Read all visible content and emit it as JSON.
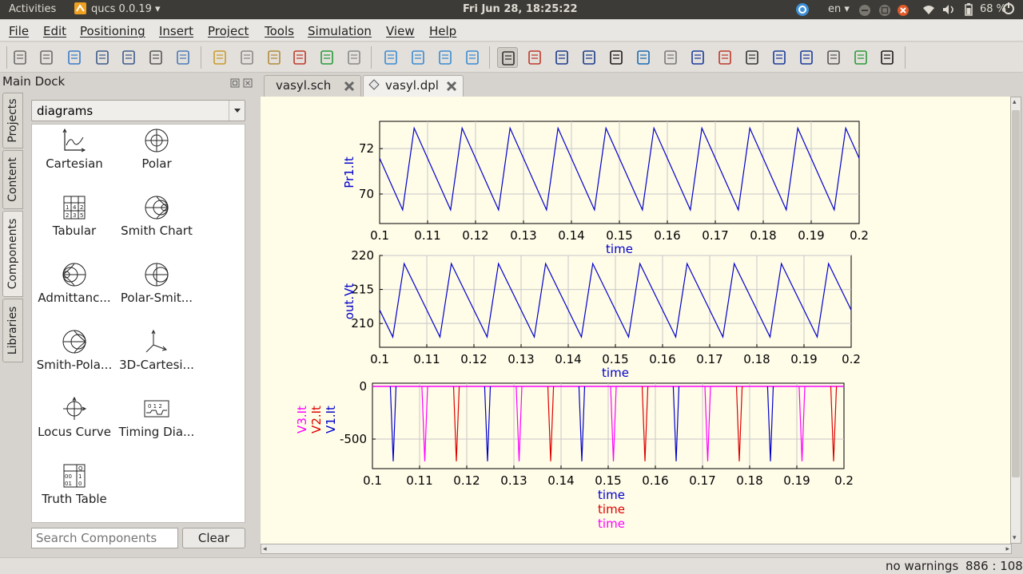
{
  "system_bar": {
    "activities": "Activities",
    "app_name": "qucs 0.0.19",
    "datetime": "Fri Jun 28, 18:25:22",
    "language": "en",
    "battery": "68 %"
  },
  "menu": [
    "File",
    "Edit",
    "Positioning",
    "Insert",
    "Project",
    "Tools",
    "Simulation",
    "View",
    "Help"
  ],
  "toolbar_icons": [
    "new-file-icon",
    "new-text-icon",
    "open-folder-icon",
    "save-icon",
    "save-all-icon",
    "close-icon",
    "print-icon",
    "cut-icon",
    "copy-icon",
    "paste-icon",
    "delete-icon",
    "undo-icon",
    "redo-icon",
    "zoom-fit-icon",
    "zoom-selection-icon",
    "zoom-in-icon",
    "zoom-out-icon",
    "select-arrow-icon",
    "edit-component-icon",
    "mirror-x-icon",
    "mirror-y-icon",
    "rotate-icon",
    "enter-subcircuit-icon",
    "exit-subcircuit-icon",
    "wire-icon",
    "wire-label-icon",
    "equation-icon",
    "ground-icon",
    "port-icon",
    "simulate-icon",
    "data-display-icon",
    "marker-icon"
  ],
  "dock": {
    "title": "Main Dock",
    "vertical_tabs": [
      "Projects",
      "Content",
      "Components",
      "Libraries"
    ],
    "category": "diagrams",
    "components": [
      {
        "label": "Cartesian",
        "icon": "cartesian-diagram-icon"
      },
      {
        "label": "Polar",
        "icon": "polar-diagram-icon"
      },
      {
        "label": "Tabular",
        "icon": "tabular-diagram-icon"
      },
      {
        "label": "Smith Chart",
        "icon": "smith-chart-icon"
      },
      {
        "label": "Admittanc...",
        "icon": "admittance-smith-icon"
      },
      {
        "label": "Polar-Smit...",
        "icon": "polar-smith-icon"
      },
      {
        "label": "Smith-Pola...",
        "icon": "smith-polar-icon"
      },
      {
        "label": "3D-Cartesi...",
        "icon": "3d-cartesian-icon"
      },
      {
        "label": "Locus Curve",
        "icon": "locus-curve-icon"
      },
      {
        "label": "Timing Dia...",
        "icon": "timing-diagram-icon"
      },
      {
        "label": "Truth Table",
        "icon": "truth-table-icon"
      }
    ],
    "search_placeholder": "Search Components",
    "clear_label": "Clear"
  },
  "tabs": [
    {
      "label": "vasyl.sch",
      "active": false
    },
    {
      "label": "vasyl.dpl",
      "active": true
    }
  ],
  "status": {
    "message": "no warnings",
    "position": "886 : 108"
  },
  "chart_data": [
    {
      "type": "line",
      "xlabel": "time",
      "ylabel": "Pr1.It",
      "xlim": [
        0.1,
        0.2
      ],
      "ylim": [
        68.7,
        73.2
      ],
      "xticks": [
        "0.1",
        "0.11",
        "0.12",
        "0.13",
        "0.14",
        "0.15",
        "0.16",
        "0.17",
        "0.18",
        "0.19",
        "0.2"
      ],
      "yticks": [
        70,
        72
      ],
      "series": [
        {
          "name": "Pr1.It",
          "color": "#0000cc",
          "shape": "sawtooth",
          "min": 69.3,
          "max": 72.9,
          "period": 0.01,
          "first_peak": 0.1072,
          "first_trough": 0.1048
        }
      ]
    },
    {
      "type": "line",
      "xlabel": "time",
      "ylabel": "out.Vt",
      "xlim": [
        0.1,
        0.2
      ],
      "ylim": [
        206.5,
        220
      ],
      "xticks": [
        "0.1",
        "0.11",
        "0.12",
        "0.13",
        "0.14",
        "0.15",
        "0.16",
        "0.17",
        "0.18",
        "0.19",
        "0.2"
      ],
      "yticks": [
        210,
        215,
        220
      ],
      "series": [
        {
          "name": "out.Vt",
          "color": "#0000cc",
          "shape": "sawtooth",
          "min": 208,
          "max": 218.8,
          "period": 0.01,
          "first_peak": 0.1052,
          "first_trough": 0.1108
        }
      ]
    },
    {
      "type": "line",
      "xlabel": "time",
      "ylabel": "",
      "xlim": [
        0.1,
        0.2
      ],
      "ylim": [
        -780,
        30
      ],
      "xticks": [
        "0.1",
        "0.11",
        "0.12",
        "0.13",
        "0.14",
        "0.15",
        "0.16",
        "0.17",
        "0.18",
        "0.19",
        "0.2"
      ],
      "yticks": [
        0,
        -500
      ],
      "series": [
        {
          "name": "V1.It",
          "color": "#0000cc",
          "spike_depth": -710,
          "spikes": [
            0.1044,
            0.1244,
            0.1444,
            0.1644,
            0.1844
          ]
        },
        {
          "name": "V2.It",
          "color": "#dd0000",
          "spike_depth": -710,
          "spikes": [
            0.1178,
            0.1378,
            0.1578,
            0.1778,
            0.1978
          ]
        },
        {
          "name": "V3.It",
          "color": "#ff00ff",
          "spike_depth": -710,
          "spikes": [
            0.1111,
            0.1311,
            0.1511,
            0.1711,
            0.1911
          ]
        }
      ]
    }
  ]
}
